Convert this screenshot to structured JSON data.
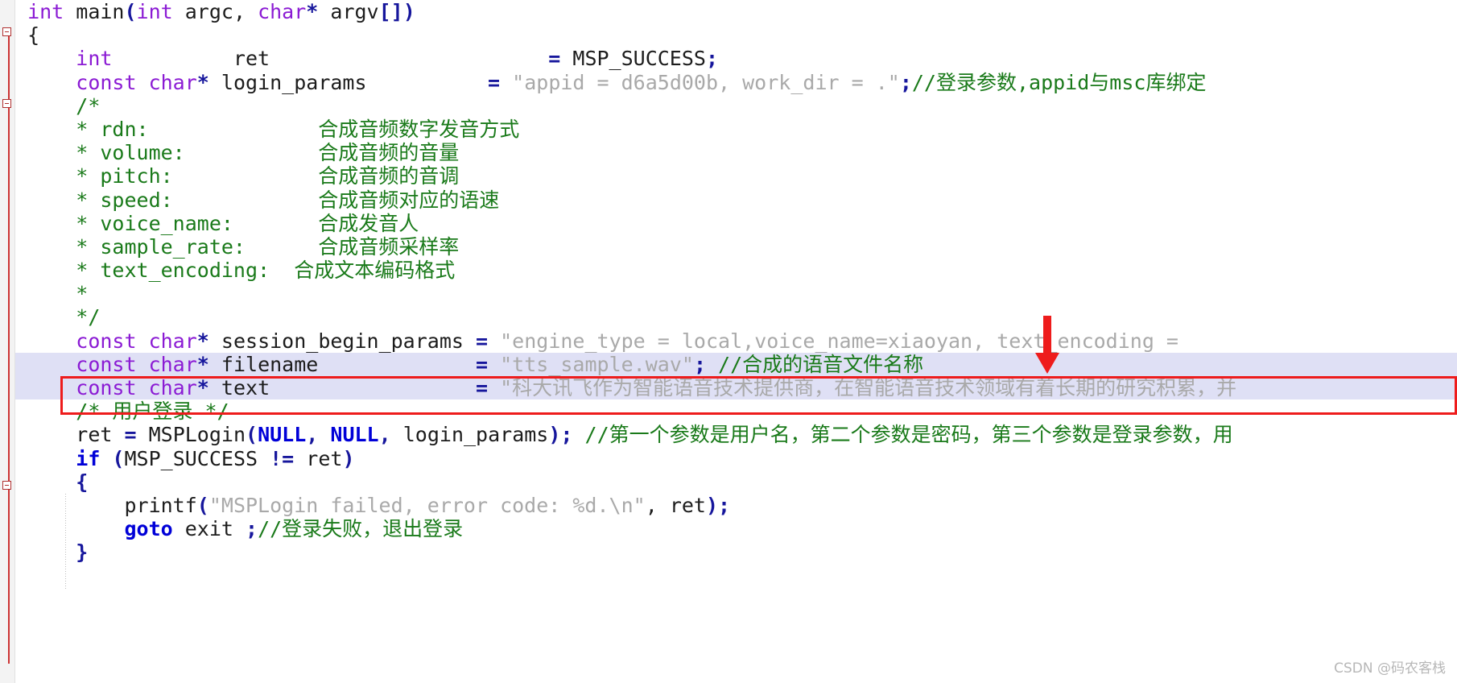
{
  "editor": {
    "language": "C",
    "accent_highlight": "#dfe0f5",
    "annotation_color": "#ee1c1c",
    "comment_color": "#1a7a1a",
    "keyword_color": "#8b1bd4",
    "string_color": "#a9a9a9"
  },
  "watermark": {
    "text": "CSDN @码农客栈"
  },
  "code": {
    "l1": {
      "kw1": "int",
      "fn": " main",
      "p1": "(",
      "kw2": "int",
      "arg1": " argc, ",
      "kw3": "char",
      "star": "*",
      "arg2": " argv",
      "brackets": "[]",
      "p2": ")"
    },
    "l2": {
      "brace": "{"
    },
    "l3": {
      "kw": "int",
      "name": "          ret",
      "gap": "                       ",
      "eq": "=",
      "value": " MSP_SUCCESS",
      "semi": ";"
    },
    "l4": {
      "kw1": "const",
      "kw2": " char",
      "star": "*",
      "name": " login_params",
      "gap": "          ",
      "eq": "=",
      "str": " \"appid = d6a5d00b, work_dir = .\"",
      "semi": ";",
      "comment": "//登录参数,appid与msc库绑定"
    },
    "l5": {
      "c": "/*"
    },
    "l6": {
      "c": "* rdn:              合成音频数字发音方式"
    },
    "l7": {
      "c": "* volume:           合成音频的音量"
    },
    "l8": {
      "c": "* pitch:            合成音频的音调"
    },
    "l9": {
      "c": "* speed:            合成音频对应的语速"
    },
    "l10": {
      "c": "* voice_name:       合成发音人"
    },
    "l11": {
      "c": "* sample_rate:      合成音频采样率"
    },
    "l12": {
      "c": "* text_encoding:  合成文本编码格式"
    },
    "l13": {
      "c": "*"
    },
    "l14": {
      "c": "*/"
    },
    "l15": {
      "kw1": "const",
      "kw2": " char",
      "star": "*",
      "name": " session_begin_params ",
      "eq": "=",
      "str": " \"engine_type = local,voice_name=xiaoyan, text_encoding ="
    },
    "l16": {
      "kw1": "const",
      "kw2": " char",
      "star": "*",
      "name": " filename",
      "gap": "             ",
      "eq": "=",
      "str": " \"tts_sample.wav\"",
      "semi": ";",
      "comment": " //合成的语音文件名称"
    },
    "l17": {
      "kw1": "const",
      "kw2": " char",
      "star": "*",
      "name": " text",
      "gap": "                 ",
      "eq": "=",
      "str": " \"科大讯飞作为智能语音技术提供商，在智能语音技术领域有着长期的研究积累，并"
    },
    "l18": {
      "c": "/* 用户登录 */"
    },
    "l19": {
      "lhs": "ret ",
      "eq": "=",
      "call": " MSPLogin",
      "p1": "(",
      "null1": "NULL",
      "comma1": ", ",
      "null2": "NULL",
      "comma2": ", ",
      "arg": "login_params",
      "p2": ")",
      "semi": ";",
      "comment": " //第一个参数是用户名，第二个参数是密码，第三个参数是登录参数，用"
    },
    "l20": {
      "kw": "if",
      "p1": " (",
      "cond": "MSP_SUCCESS ",
      "op": "!=",
      "rhs": " ret",
      "p2": ")"
    },
    "l21": {
      "brace": "{"
    },
    "l22": {
      "call": "printf",
      "p1": "(",
      "str": "\"MSPLogin failed, error code: %d.\\n\"",
      "comma": ", ",
      "arg": "ret",
      "p2": ")",
      "semi": ";"
    },
    "l23": {
      "kw": "goto",
      "label": " exit ",
      "semi": ";",
      "comment": "//登录失败，退出登录"
    },
    "l24": {
      "brace": "}"
    }
  }
}
